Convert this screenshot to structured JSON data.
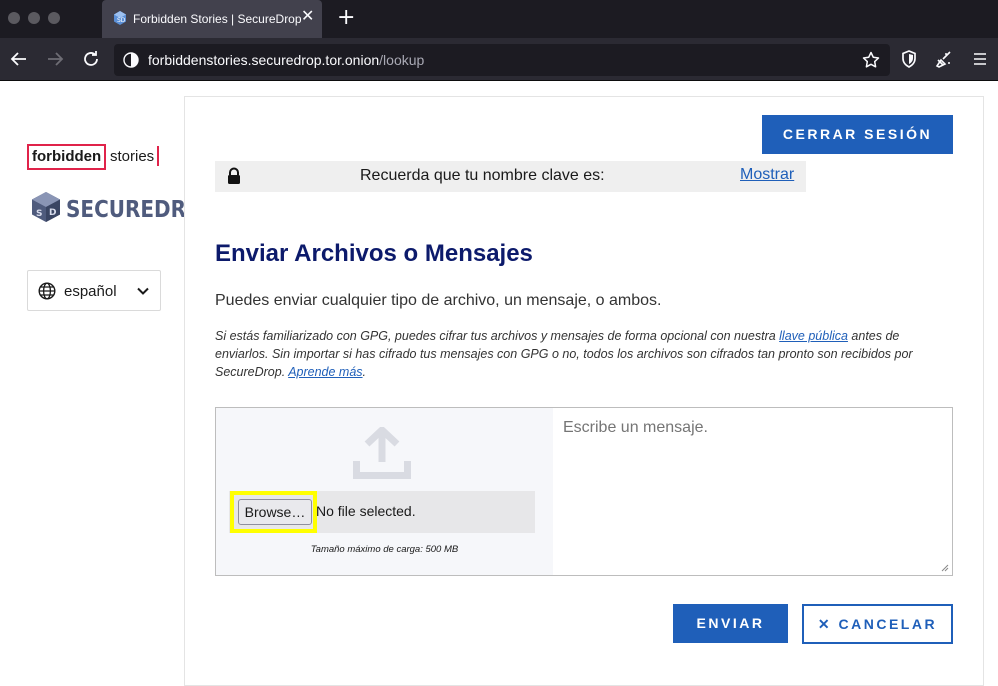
{
  "browser": {
    "tab": {
      "title": "Forbidden Stories | SecureDrop",
      "close_glyph": "✕"
    },
    "new_tab_glyph": "+",
    "url": {
      "host": "forbiddenstories.securedrop.tor.onion",
      "path": "/lookup"
    }
  },
  "sidebar": {
    "logo_forbidden": "forbidden",
    "logo_stories": "stories",
    "logo_securedrop": "SECUREDROP",
    "language": {
      "label": "español",
      "icon": "globe-icon"
    }
  },
  "main": {
    "logout_label": "CERRAR SESIÓN",
    "codename": {
      "text": "Recuerda que tu nombre clave es:",
      "show_label": "Mostrar"
    },
    "heading": "Enviar Archivos o Mensajes",
    "subtitle": "Puedes enviar cualquier tipo de archivo, un mensaje, o ambos.",
    "notice": {
      "part1": "Si estás familiarizado con GPG, puedes cifrar tus archivos y mensajes de forma opcional con nuestra ",
      "link1": "llave pública",
      "part2": " antes de enviarlos. Sin importar si has cifrado tus mensajes con GPG o no, todos los archivos son cifrados tan pronto son recibidos por SecureDrop. ",
      "link2": "Aprende más",
      "part3": "."
    },
    "upload": {
      "browse_label": "Browse…",
      "file_status": "No file selected.",
      "max_size": "Tamaño máximo de carga: 500 MB"
    },
    "message_placeholder": "Escribe un mensaje.",
    "send_label": "ENVIAR",
    "cancel_label": "✕ CANCELAR"
  },
  "colors": {
    "primary_blue": "#1f5fb9",
    "heading_navy": "#0c1a6b",
    "forbidden_red": "#e0234a",
    "highlight_yellow": "#ffff00"
  }
}
